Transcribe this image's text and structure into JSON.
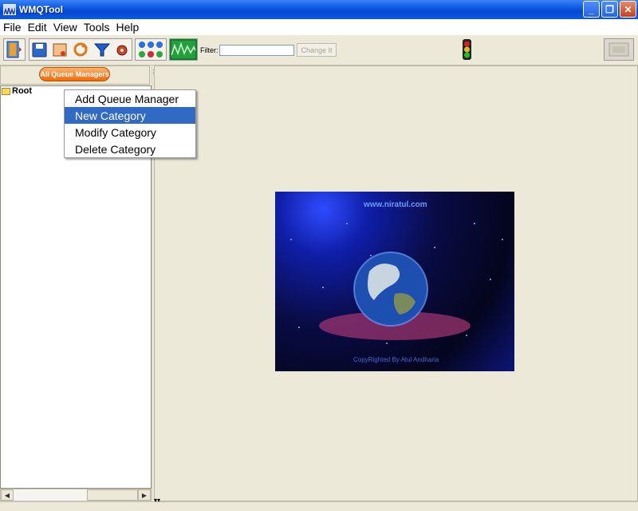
{
  "window": {
    "title": "WMQTool"
  },
  "menu": [
    "File",
    "Edit",
    "View",
    "Tools",
    "Help"
  ],
  "toolbar": {
    "filter_label": "Filter:",
    "filter_value": "",
    "change_button": "Change It"
  },
  "left_panel": {
    "all_queue_managers_button": "All Queue Managers",
    "tree_root": "Root"
  },
  "context_menu": {
    "items": [
      "Add Queue Manager",
      "New Category",
      "Modify Category",
      "Delete Category"
    ],
    "active_index": 1
  },
  "splash": {
    "url": "www.niratul.com",
    "copyright": "CopyRighted By Atul Andharia"
  },
  "icons": {
    "exit": "exit-door-icon",
    "save": "save-icon",
    "hand": "hand-config-icon",
    "refresh": "refresh-icon",
    "filter": "filter-funnel-icon",
    "settings": "gear-settings-icon",
    "status": "status-matrix-icon",
    "monitor": "monitor-graph-icon",
    "traffic": "traffic-light-icon",
    "extra": "disabled-panel-icon"
  },
  "colors": {
    "accent": "#316ac5",
    "title_bar": "#0a56e0",
    "button_orange": "#f06a08"
  }
}
